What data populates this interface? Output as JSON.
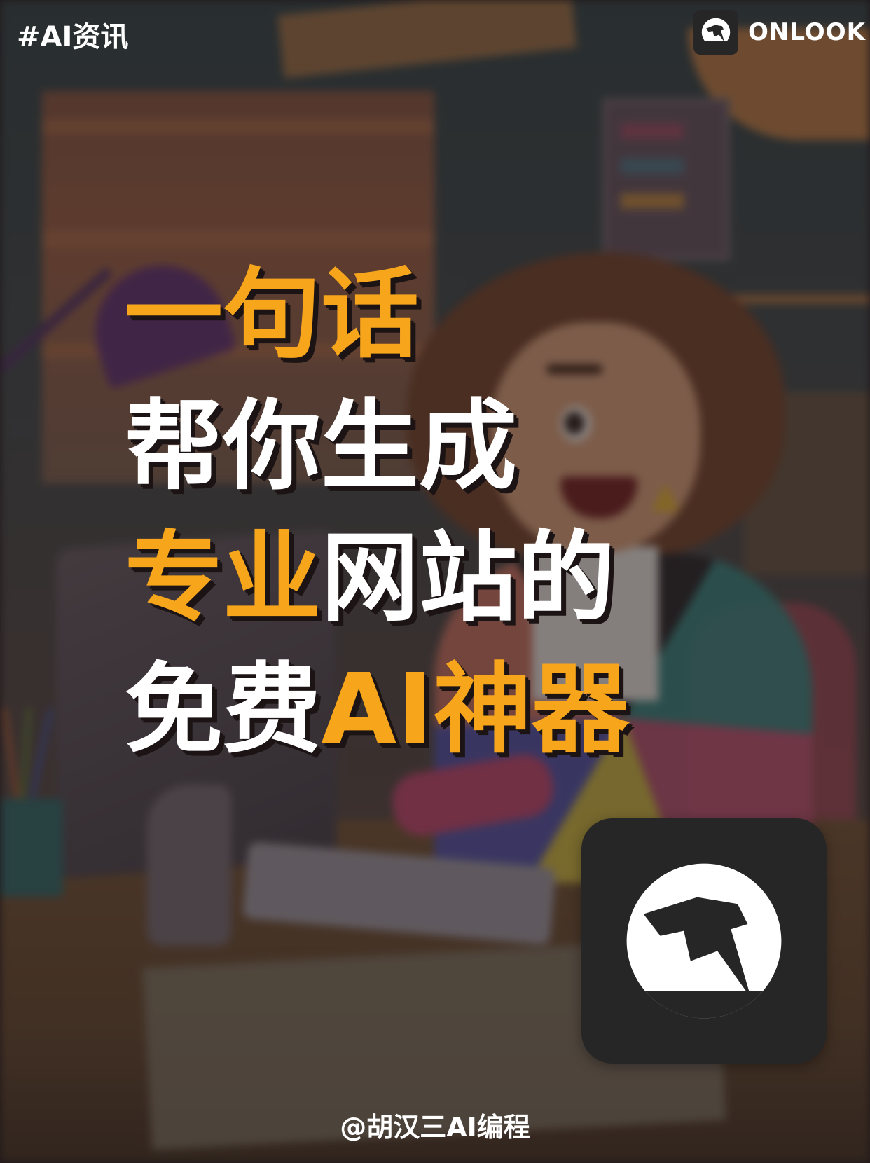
{
  "tag": "#AI资讯",
  "brand": {
    "name": "ONLOOK",
    "logo_icon": "onlook-logo-icon"
  },
  "headline": {
    "line1": [
      {
        "text": "一句话",
        "color": "#f7a51b"
      }
    ],
    "line2": [
      {
        "text": "帮你生成",
        "color": "#ffffff"
      }
    ],
    "line3": [
      {
        "text": "专业",
        "color": "#f7a51b"
      },
      {
        "text": "网站的",
        "color": "#ffffff"
      }
    ],
    "line4": [
      {
        "text": "免费",
        "color": "#ffffff"
      },
      {
        "text": "AI神器",
        "color": "#f7a51b"
      }
    ]
  },
  "app_icon": {
    "name": "onlook-app-icon",
    "background": "#262626"
  },
  "credit": "@胡汉三AI编程",
  "colors": {
    "accent": "#f7a51b",
    "text": "#ffffff"
  }
}
